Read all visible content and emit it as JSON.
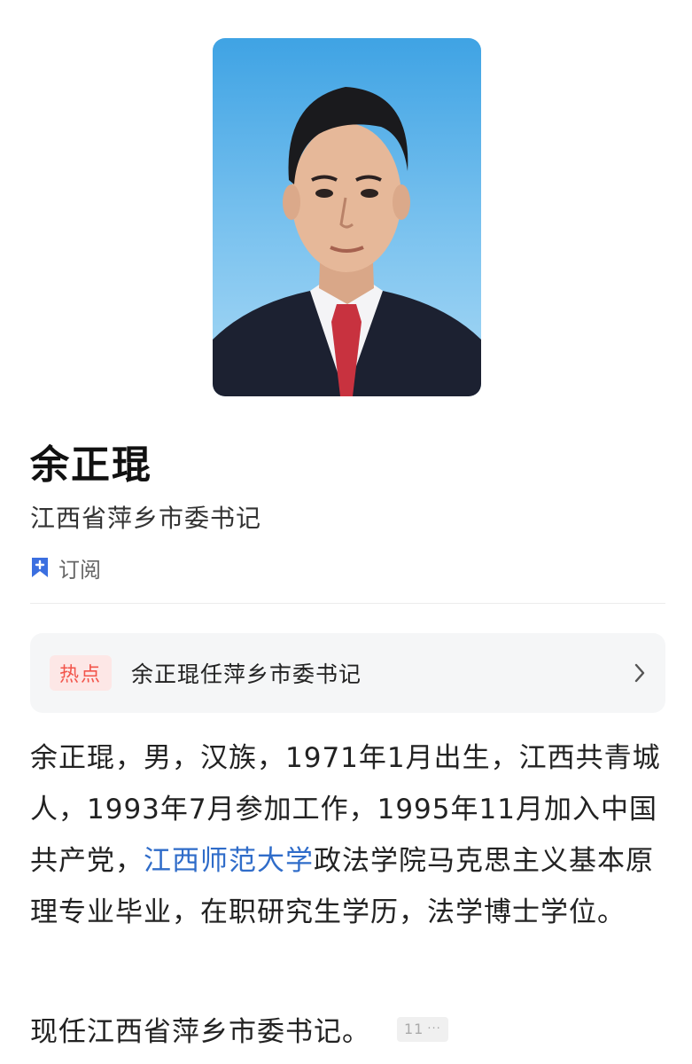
{
  "profile": {
    "name": "余正琨",
    "title": "江西省萍乡市委书记",
    "subscribe_label": "订阅"
  },
  "hot": {
    "badge": "热点",
    "headline": "余正琨任萍乡市委书记"
  },
  "bio": {
    "part1": "余正琨，男，汉族，1971年1月出生，江西共青城人，1993年7月参加工作，1995年11月加入中国共产党，",
    "link": "江西师范大学",
    "part2": "政法学院马克思主义基本原理专业毕业，在职研究生学历，法学博士学位。"
  },
  "current": {
    "text": "现任江西省萍乡市委书记。",
    "ref_number": "11",
    "ref_more": "···"
  },
  "colors": {
    "link": "#2f6cc9",
    "hot_badge_text": "#f2554b",
    "hot_badge_bg": "#fde7e6",
    "subscribe_icon": "#3b6fe0",
    "card_bg": "#f5f6f7"
  },
  "icons": {
    "subscribe": "bookmark-plus-icon",
    "hot_arrow": "chevron-right-icon"
  }
}
